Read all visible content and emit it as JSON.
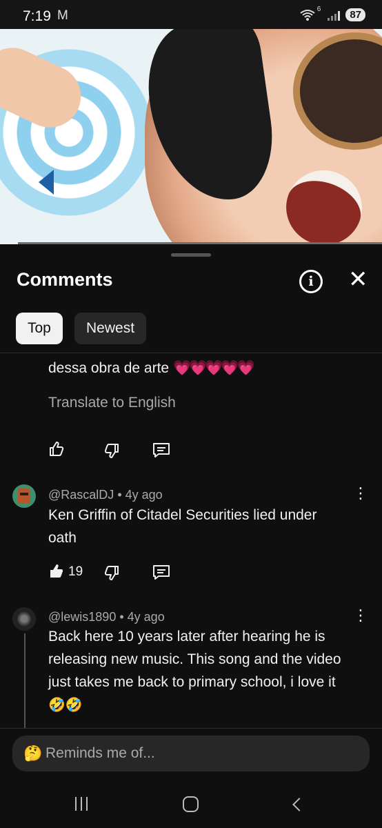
{
  "status": {
    "time": "7:19",
    "mail_icon": "M",
    "network": "6",
    "battery": "87"
  },
  "sheet": {
    "title": "Comments",
    "chips": [
      {
        "label": "Top",
        "selected": true
      },
      {
        "label": "Newest",
        "selected": false
      }
    ]
  },
  "comments": [
    {
      "text": "dessa obra de arte",
      "emoji": "💗💗💗💗💗",
      "translate": "Translate to English",
      "likes": ""
    },
    {
      "handle": "@RascalDJ",
      "age": "4y ago",
      "text": "Ken Griffin of Citadel Securities lied under oath",
      "likes": "19"
    },
    {
      "handle": "@lewis1890",
      "age": "4y ago",
      "text": "Back here 10 years later after hearing he is releasing new music. This song and the video just takes me back to primary school, i love it",
      "emoji": "🤣🤣"
    }
  ],
  "input": {
    "emoji": "🤔",
    "placeholder": "Reminds me of..."
  },
  "icons": {
    "like": "thumbs-up-icon",
    "dislike": "thumbs-down-icon",
    "reply": "reply-icon",
    "more": "more-vert-icon",
    "info": "info-icon",
    "close": "close-icon"
  },
  "colors": {
    "background": "#0f0f0f",
    "chip_selected": "#f1f1f1",
    "chip": "#272727",
    "muted_text": "#aaaaaa"
  }
}
